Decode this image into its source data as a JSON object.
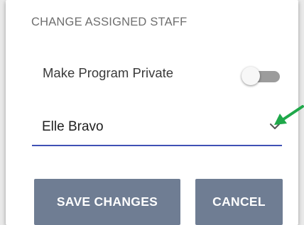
{
  "dialog": {
    "title": "CHANGE ASSIGNED STAFF",
    "private_toggle": {
      "label": "Make Program Private",
      "on": false
    },
    "staff_select": {
      "value": "Elle Bravo"
    },
    "buttons": {
      "save_label": "SAVE CHANGES",
      "cancel_label": "CANCEL"
    }
  },
  "colors": {
    "button_bg": "#6f7d93",
    "select_underline": "#3f51b5",
    "annotation_arrow": "#1fa84a"
  },
  "icons": {
    "chevron": "chevron-down-icon",
    "annotation": "green-arrow-pointer"
  }
}
